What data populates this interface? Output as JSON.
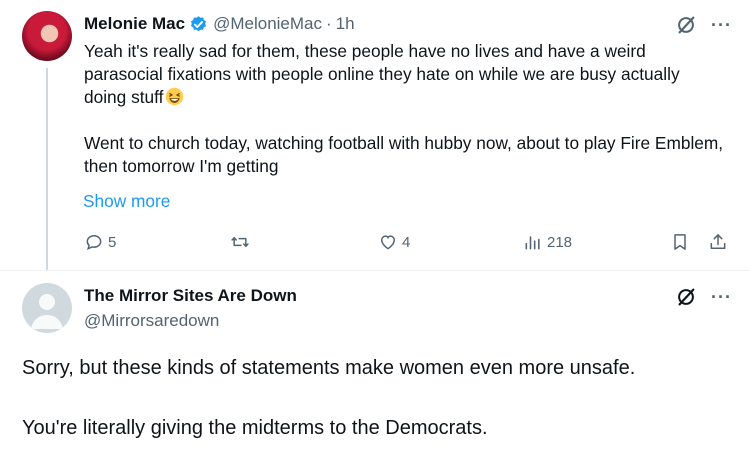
{
  "tweet1": {
    "display_name": "Melonie Mac",
    "handle": "@MelonieMac",
    "separator": "·",
    "time": "1h",
    "text": "Yeah it's really sad for them, these people have no lives and have a weird parasocial fixations with people online they hate on while we are busy actually doing stuff",
    "emoji": "grinning-squinting-face",
    "text2": "Went to church today, watching football with hubby now, about to play Fire Emblem, then tomorrow I'm getting",
    "show_more": "Show more",
    "replies": "5",
    "retweets": "",
    "likes": "4",
    "views": "218",
    "colors": {
      "verified": "#1d9bf0",
      "link": "#1d9bf0",
      "muted": "#536471"
    }
  },
  "tweet2": {
    "display_name": "The Mirror Sites Are Down",
    "handle": "@Mirrorsaredown",
    "paragraph1": "Sorry, but these kinds of statements make women even more unsafe.",
    "paragraph2": "You're literally giving the midterms to the Democrats."
  }
}
